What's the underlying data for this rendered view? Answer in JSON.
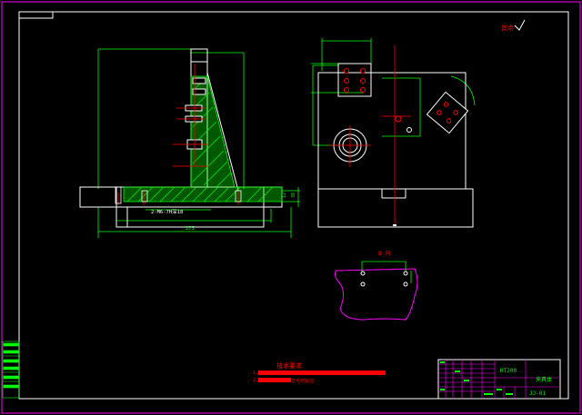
{
  "colors": {
    "background": "#000000",
    "outline": "#ffffff",
    "dimension": "#00ff00",
    "centerline": "#ff0000",
    "hatch": "#00ff00",
    "detail_outline": "#ff00ff",
    "title_block": "#ff00ff",
    "note": "#ff0000",
    "label": "#ff0000"
  },
  "roughness_note": "其余",
  "thread_callout": "2-M6-7H深18",
  "overall_dim": "275",
  "height_dims": [
    "12",
    "38"
  ],
  "detail_label": "B 向",
  "tech_requirements": {
    "title": "技术要求",
    "items": [
      {
        "num": "1.",
        "text": ""
      },
      {
        "num": "2.",
        "text": "去毛刺锐边"
      }
    ]
  },
  "title_block": {
    "material": "HT200",
    "part_name": "夹具体",
    "code": "JJ-01"
  }
}
